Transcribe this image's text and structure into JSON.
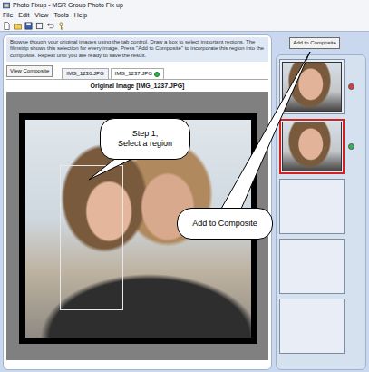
{
  "window": {
    "title": "Photo Fixup - MSR Group Photo Fix up"
  },
  "menu": [
    "File",
    "Edit",
    "View",
    "Tools",
    "Help"
  ],
  "instructions": "Browse though your original images using the tab control. Draw a box to select important regions. The filmstrip shows this selection for every image. Press \"Add to Composite\" to incorporate this region into the composite. Repeat until you are ready to save the result.",
  "view_composite": "View Composite",
  "tabs": [
    {
      "label": "IMG_1236.JPG",
      "selected": false,
      "marked": false
    },
    {
      "label": "IMG_1237.JPG",
      "selected": true,
      "marked": true
    }
  ],
  "image_title": "Original Image [IMG_1237.JPG]",
  "add_button": "Add to Composite",
  "filmstrip": [
    {
      "kind": "photo",
      "selected": false,
      "color": "#e03a3a"
    },
    {
      "kind": "photo",
      "selected": true,
      "color": "#34b552"
    },
    {
      "kind": "empty",
      "selected": false
    },
    {
      "kind": "empty",
      "selected": false
    },
    {
      "kind": "empty",
      "selected": false
    }
  ],
  "callouts": [
    {
      "lines": [
        "Step 1,",
        "Select a region"
      ]
    },
    {
      "lines": [
        "Add to Composite"
      ]
    }
  ]
}
